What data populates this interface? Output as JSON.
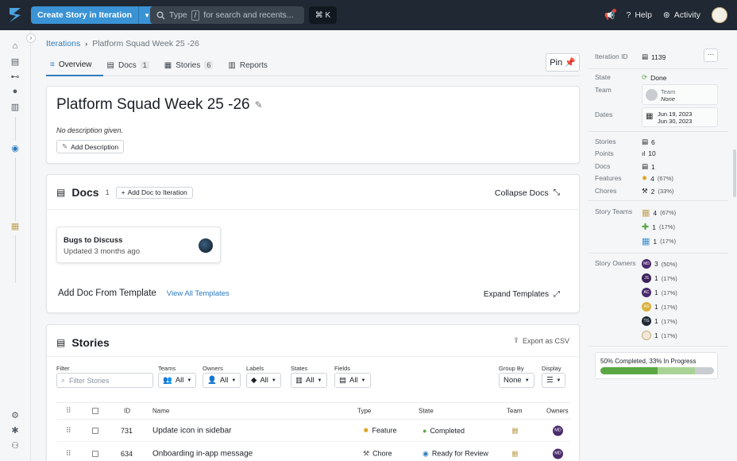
{
  "topbar": {
    "create_label": "Create Story in Iteration",
    "search_prefix": "Type",
    "search_key": "/",
    "search_suffix": "for search and recents...",
    "shortcut": "⌘ K",
    "help": "Help",
    "activity": "Activity"
  },
  "breadcrumb": {
    "parent": "Iterations",
    "current": "Platform Squad Week 25 -26"
  },
  "tabs": [
    {
      "label": "Overview",
      "count": ""
    },
    {
      "label": "Docs",
      "count": "1"
    },
    {
      "label": "Stories",
      "count": "6"
    },
    {
      "label": "Reports",
      "count": ""
    }
  ],
  "pin_label": "Pin",
  "iteration": {
    "title": "Platform Squad Week 25 -26",
    "no_description": "No description given.",
    "add_description": "Add Description"
  },
  "docs": {
    "heading": "Docs",
    "count": "1",
    "add_button": "Add Doc to Iteration",
    "collapse": "Collapse Docs",
    "doc_title": "Bugs to Discuss",
    "doc_updated": "Updated 3 months ago",
    "template_heading": "Add Doc From Template",
    "view_all": "View All Templates",
    "expand": "Expand Templates"
  },
  "stories": {
    "heading": "Stories",
    "export": "Export as CSV",
    "filter_label": "Filter",
    "filter_placeholder": "Filter Stories",
    "filters": [
      {
        "label": "Teams",
        "value": "All"
      },
      {
        "label": "Owners",
        "value": "All"
      },
      {
        "label": "Labels",
        "value": "All"
      },
      {
        "label": "States",
        "value": "All"
      },
      {
        "label": "Fields",
        "value": "All"
      }
    ],
    "group_by_label": "Group By",
    "group_by_value": "None",
    "display_label": "Display",
    "columns": {
      "id": "ID",
      "name": "Name",
      "type": "Type",
      "state": "State",
      "team": "Team",
      "owners": "Owners"
    },
    "rows": [
      {
        "id": "731",
        "name": "Update icon in sidebar",
        "type": "Feature",
        "state": "Completed",
        "owner": "MD"
      },
      {
        "id": "634",
        "name": "Onboarding in-app message",
        "type": "Chore",
        "state": "Ready for Review",
        "owner": "MD"
      }
    ]
  },
  "sidebar": {
    "iteration_id_label": "Iteration ID",
    "iteration_id": "1139",
    "more": "···",
    "state_label": "State",
    "state": "Done",
    "team_label": "Team",
    "team_heading": "Team",
    "team_value": "None",
    "dates_label": "Dates",
    "date_start": "Jun 19, 2023",
    "date_end": "Jun 30, 2023",
    "stats": [
      {
        "label": "Stories",
        "value": "6"
      },
      {
        "label": "Points",
        "value": "10"
      },
      {
        "label": "Docs",
        "value": "1"
      },
      {
        "label": "Features",
        "value": "4",
        "pct": "(67%)"
      },
      {
        "label": "Chores",
        "value": "2",
        "pct": "(33%)"
      }
    ],
    "story_teams_label": "Story Teams",
    "story_teams": [
      {
        "value": "4",
        "pct": "(67%)"
      },
      {
        "value": "1",
        "pct": "(17%)"
      },
      {
        "value": "1",
        "pct": "(17%)"
      }
    ],
    "story_owners_label": "Story Owners",
    "story_owners": [
      {
        "initials": "MD",
        "color": "#4b2a6d",
        "value": "3",
        "pct": "(50%)"
      },
      {
        "initials": "JS",
        "color": "#3b2359",
        "value": "1",
        "pct": "(17%)"
      },
      {
        "initials": "AC",
        "color": "#4a2a6a",
        "value": "1",
        "pct": "(17%)"
      },
      {
        "initials": "AS",
        "color": "#d9b23c",
        "value": "1",
        "pct": "(17%)"
      },
      {
        "initials": "TG",
        "color": "#1f2833",
        "value": "1",
        "pct": "(17%)"
      },
      {
        "initials": "",
        "color": "#f2e7da",
        "value": "1",
        "pct": "(17%)"
      }
    ],
    "progress_label": "50% Completed, 33% In Progress",
    "progress_completed": 0.5,
    "progress_in_progress": 0.33
  },
  "colors": {
    "accent": "#3a93d4",
    "topbar": "#1f2833",
    "done": "#5aa845",
    "link": "#2d7cbe"
  }
}
